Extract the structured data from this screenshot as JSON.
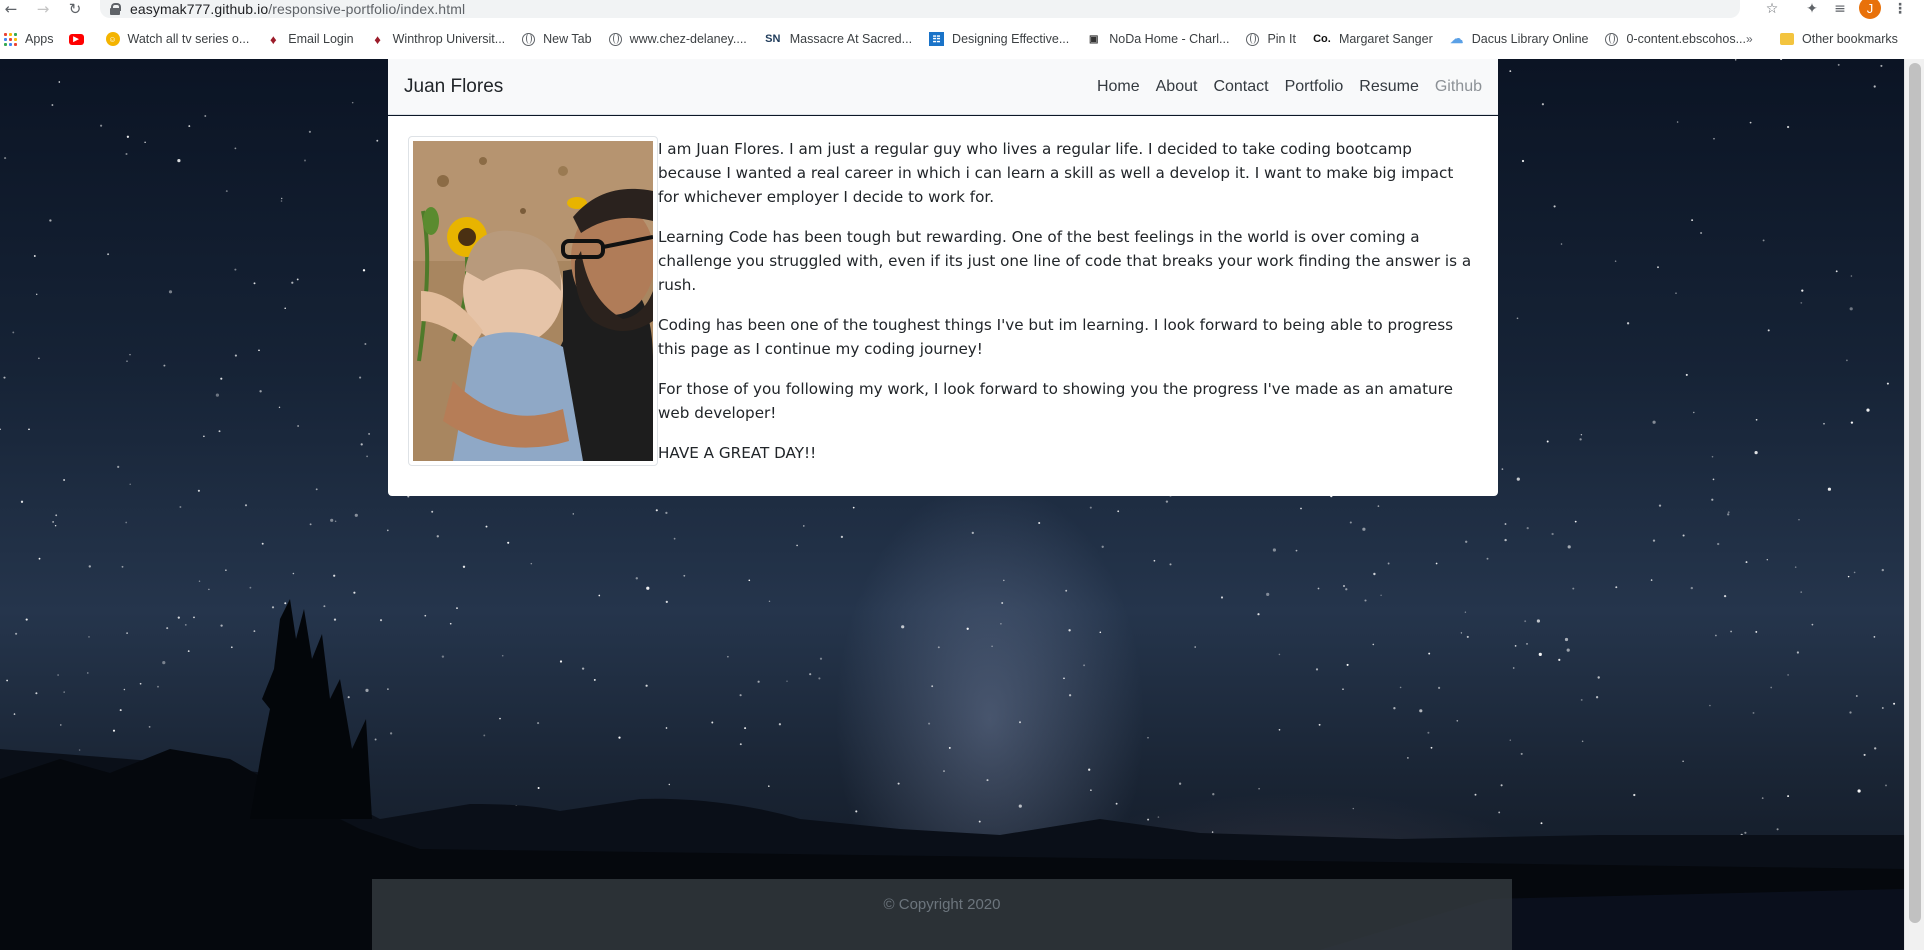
{
  "browser": {
    "url_host": "easymak777.github.io",
    "url_path": "/responsive-portfolio/index.html",
    "profile_initial": "J",
    "bookmarks": [
      {
        "label": "Apps",
        "icon": "apps-grid-icon"
      },
      {
        "label": "",
        "icon": "youtube-icon"
      },
      {
        "label": "Watch all tv series o...",
        "icon": "smiley-cat-icon"
      },
      {
        "label": "Email Login",
        "icon": "winthrop-eagle-icon"
      },
      {
        "label": "Winthrop Universit...",
        "icon": "winthrop-eagle-icon"
      },
      {
        "label": "New Tab",
        "icon": "globe-icon"
      },
      {
        "label": "www.chez-delaney....",
        "icon": "globe-icon"
      },
      {
        "label": "Massacre At Sacred...",
        "icon": "sn-icon"
      },
      {
        "label": "Designing Effective...",
        "icon": "book-icon"
      },
      {
        "label": "NoDa Home - Charl...",
        "icon": "noda-icon"
      },
      {
        "label": "Pin It",
        "icon": "globe-icon"
      },
      {
        "label": "Margaret Sanger",
        "icon": "co-icon"
      },
      {
        "label": "Dacus Library Online",
        "icon": "cloud-icon"
      },
      {
        "label": "0-content.ebscohos...",
        "icon": "globe-icon"
      }
    ],
    "more_bookmarks": "»",
    "other_bookmarks": "Other bookmarks"
  },
  "site": {
    "brand": "Juan Flores",
    "nav": [
      "Home",
      "About",
      "Contact",
      "Portfolio",
      "Resume",
      "Github"
    ],
    "bio": [
      "I am Juan Flores. I am just a regular guy who lives a regular life. I decided to take coding bootcamp because I wanted a real career in which i can learn a skill as well a develop it. I want to make big impact for whichever employer I decide to work for.",
      "Learning Code has been tough but rewarding. One of the best feelings in the world is over coming a challenge you struggled with, even if its just one line of code that breaks your work finding the answer is a rush.",
      "Coding has been one of the toughest things I've but im learning. I look forward to being able to progress this page as I continue my coding journey!",
      "For those of you following my work, I look forward to showing you the progress I've made as an amature web developer!",
      "HAVE A GREAT DAY!!"
    ],
    "footer": "© Copyright 2020"
  },
  "colors": {
    "navbar_bg": "#f8f9fa",
    "footer_bg": "#343a40",
    "text": "#212529",
    "muted_link": "#8c9196",
    "avatar_orange": "#e8710a"
  }
}
